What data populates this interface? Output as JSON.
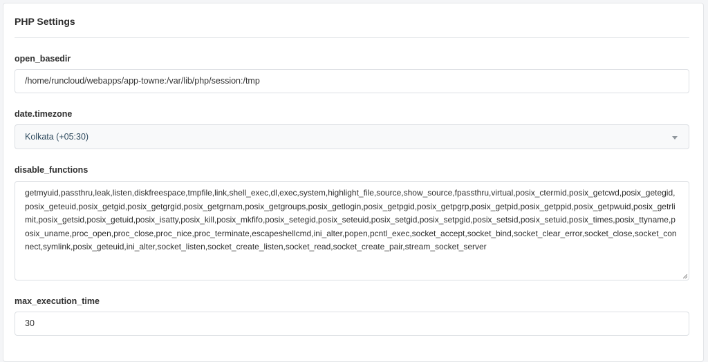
{
  "card": {
    "title": "PHP Settings"
  },
  "fields": {
    "open_basedir": {
      "label": "open_basedir",
      "value": "/home/runcloud/webapps/app-towne:/var/lib/php/session:/tmp"
    },
    "date_timezone": {
      "label": "date.timezone",
      "selected": "Kolkata (+05:30)"
    },
    "disable_functions": {
      "label": "disable_functions",
      "value": "getmyuid,passthru,leak,listen,diskfreespace,tmpfile,link,shell_exec,dl,exec,system,highlight_file,source,show_source,fpassthru,virtual,posix_ctermid,posix_getcwd,posix_getegid,posix_geteuid,posix_getgid,posix_getgrgid,posix_getgrnam,posix_getgroups,posix_getlogin,posix_getpgid,posix_getpgrp,posix_getpid,posix_getppid,posix_getpwuid,posix_getrlimit,posix_getsid,posix_getuid,posix_isatty,posix_kill,posix_mkfifo,posix_setegid,posix_seteuid,posix_setgid,posix_setpgid,posix_setsid,posix_setuid,posix_times,posix_ttyname,posix_uname,proc_open,proc_close,proc_nice,proc_terminate,escapeshellcmd,ini_alter,popen,pcntl_exec,socket_accept,socket_bind,socket_clear_error,socket_close,socket_connect,symlink,posix_geteuid,ini_alter,socket_listen,socket_create_listen,socket_read,socket_create_pair,stream_socket_server"
    },
    "max_execution_time": {
      "label": "max_execution_time",
      "value": "30"
    }
  },
  "icons": {
    "select_caret": "caret-down-icon",
    "resize": "resize-handle-icon"
  },
  "colors": {
    "page_bg": "#f4f5f7",
    "card_bg": "#ffffff",
    "border": "#dcdfe3",
    "select_text": "#2e4a5e"
  }
}
